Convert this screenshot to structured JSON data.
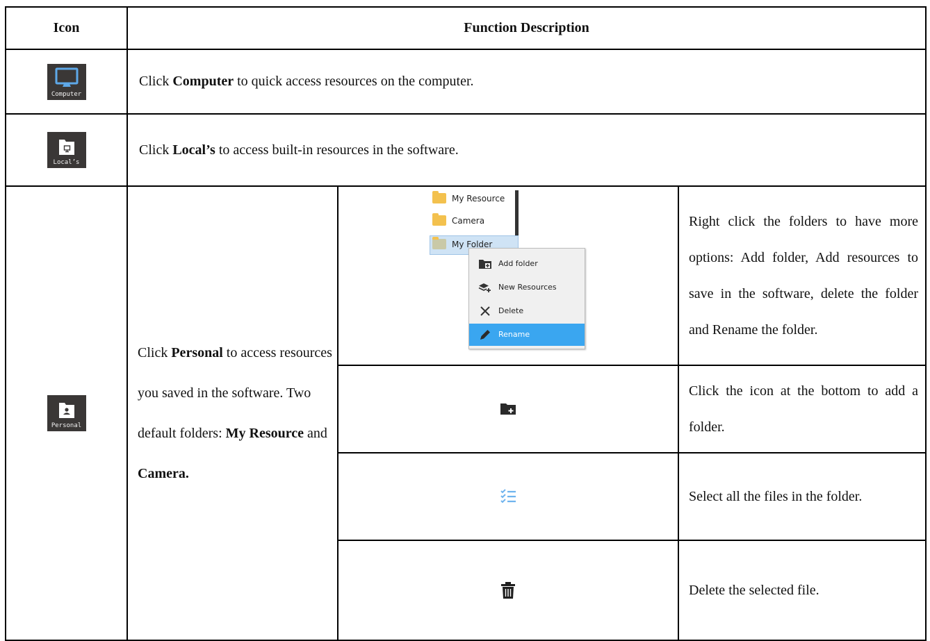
{
  "header": {
    "icon_col": "Icon",
    "desc_col": "Function Description"
  },
  "rows": {
    "computer": {
      "tile_label": "Computer",
      "text_pre": "Click ",
      "text_bold": "Computer",
      "text_post": " to quick access resources on the computer."
    },
    "locals": {
      "tile_label": "Local’s",
      "text_pre": "Click ",
      "text_bold": "Local’s",
      "text_post": " to access built-in resources in the software."
    },
    "personal": {
      "tile_label": "Personal",
      "t1": "Click ",
      "b1": "Personal",
      "t2": " to access resources you saved in the software. Two default folders: ",
      "b2": "My Resource",
      "t3": " and ",
      "b3": "Camera."
    }
  },
  "screenshot": {
    "folders": [
      "My Resource",
      "Camera",
      "My Folder"
    ],
    "menu": [
      "Add folder",
      "New Resources",
      "Delete",
      "Rename"
    ],
    "active_menu_index": 3
  },
  "subrows": [
    {
      "icon": "add-folder-icon",
      "text": "Right click the folders to have more options: Add folder, Add resources to save in the software, delete the folder and Rename the folder."
    },
    {
      "icon": "add-folder-icon",
      "text": "Click the icon at the bottom to add a folder."
    },
    {
      "icon": "select-all-icon",
      "text": "Select all the files in the folder."
    },
    {
      "icon": "trash-icon",
      "text": "Delete the selected file."
    }
  ],
  "colors": {
    "tile_bg": "#3a3736",
    "monitor_blue": "#5ea8e8",
    "select_blue": "#3aa6f0",
    "folder_yellow": "#f3c14e",
    "checklist_blue": "#6fb4ee"
  }
}
